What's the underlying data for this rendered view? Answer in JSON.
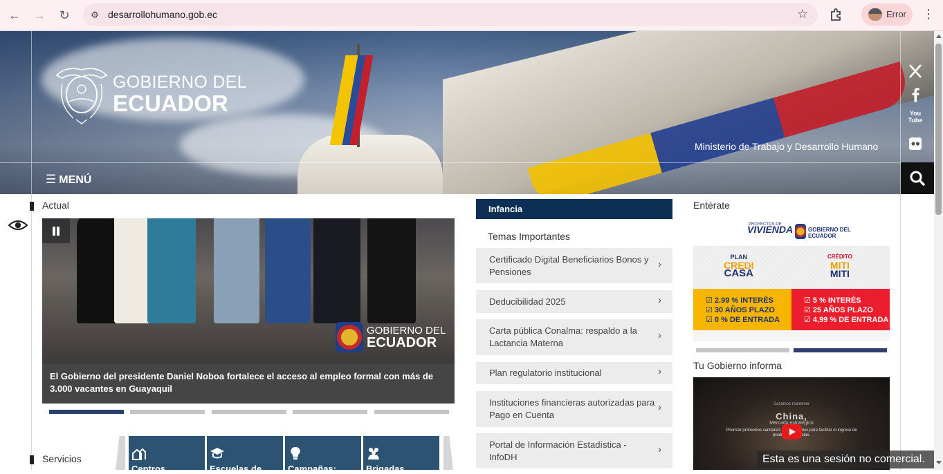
{
  "browser": {
    "url": "desarrollohumano.gob.ec",
    "profile_label": "Error"
  },
  "header": {
    "logo_line1": "GOBIERNO DEL",
    "logo_line2": "ECUADOR",
    "ministry": "Ministerio de Trabajo y Desarrollo Humano",
    "menu_label": "MENÚ",
    "social": [
      "x-icon",
      "facebook-icon",
      "youtube-icon",
      "flickr-icon"
    ],
    "youtube_text": "You Tube"
  },
  "actual": {
    "title": "Actual",
    "slide_logo1": "GOBIERNO DEL",
    "slide_logo2": "ECUADOR",
    "caption": "El Gobierno del presidente Daniel Noboa fortalece el acceso al empleo formal con más de 3.000 vacantes en Guayaquil",
    "slide_count": 5,
    "active_slide": 1
  },
  "services": {
    "title": "Servicios",
    "items": [
      {
        "label": "Centros",
        "icon": "buildings-icon"
      },
      {
        "label": "Escuelas de",
        "icon": "graduation-cap-icon"
      },
      {
        "label": "Campañas:",
        "icon": "lightbulb-icon"
      },
      {
        "label": "Brigadas",
        "icon": "people-icon"
      }
    ]
  },
  "middle": {
    "tab": "Infancia",
    "temas_title": "Temas Importantes",
    "topics": [
      "Certificado Digital Beneficiarios Bonos y Pensiones",
      "Deducibilidad 2025",
      "Carta pública Conalma: respaldo a la Lactancia Materna",
      "Plan regulatorio institucional",
      "Instituciones financieras autorizadas para Pago en Cuenta",
      "Portal de Información Estadística - InfoDH"
    ]
  },
  "right": {
    "enterate_title": "Entérate",
    "banner": {
      "viv_small": "PROYECTOS DE",
      "viv": "VIVIENDA",
      "gob": "GOBIERNO DEL\nECUADOR",
      "plan_a": "PLAN",
      "plan_b": "CREDI",
      "plan_c": "CASA",
      "miti_a": "CRÉDITO",
      "miti_b": "MITI",
      "miti_c": "MITI",
      "yellow_lines": [
        "☑ 2.99 % INTERÉS",
        "☑ 30 AÑOS PLAZO",
        "☑ 0 % DE ENTRADA"
      ],
      "red_lines": [
        "☑ 5 % INTERÉS",
        "☑ 25 AÑOS PLAZO",
        "☑ 4,99 % DE ENTRADA"
      ]
    },
    "banner_dots": 2,
    "banner_active": 2,
    "tu_gobierno_title": "Tu Gobierno informa",
    "video": {
      "top": "Sacamos mantener",
      "title": "China,",
      "sub": "Mercado estratégico",
      "desc": "Priorizar protocolos sanitarios y fitosanitarios para facilitar el ingreso de productos agrícolas."
    }
  },
  "toast": "Esta es una sesión no comercial."
}
